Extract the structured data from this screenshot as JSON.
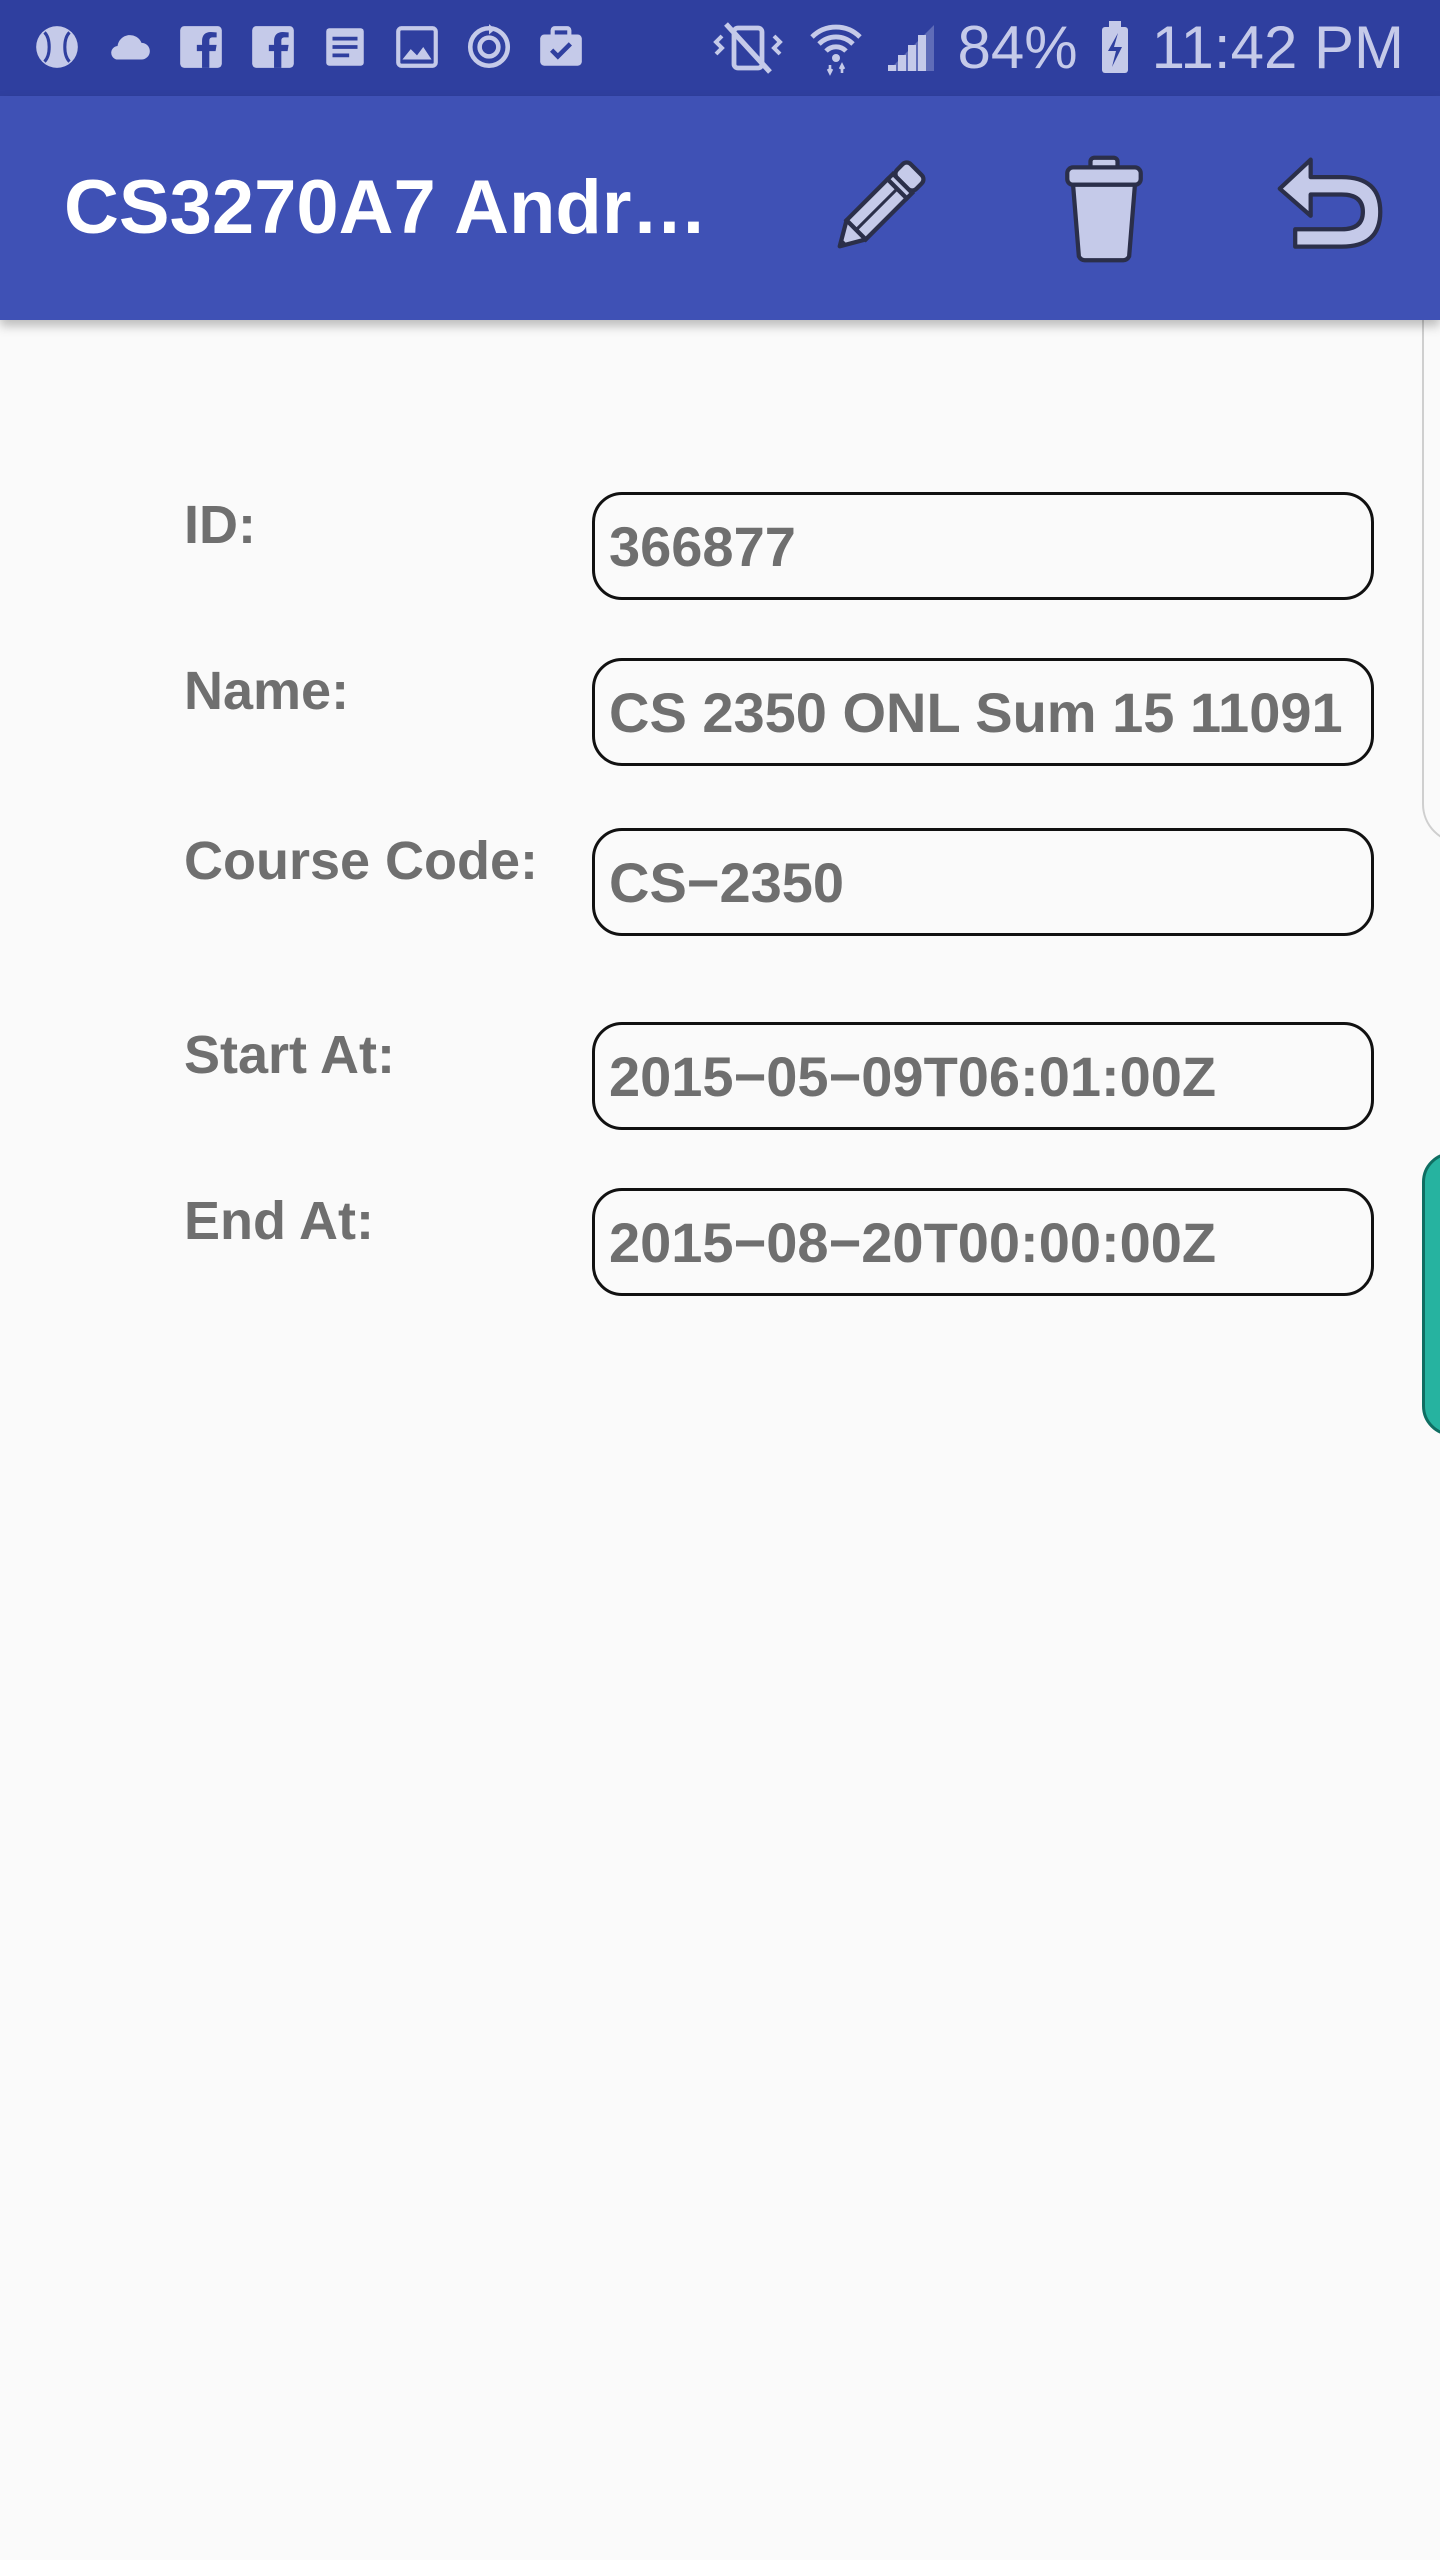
{
  "status_bar": {
    "notification_icons": [
      "baseball-icon",
      "cloud-icon",
      "facebook-icon",
      "facebook-icon",
      "document-icon",
      "image-icon",
      "sync-icon",
      "briefcase-check-icon"
    ],
    "system_icons": [
      "vibrate-mute-icon",
      "wifi-icon",
      "signal-icon",
      "battery-charging-icon"
    ],
    "battery": "84%",
    "time": "11:42 PM"
  },
  "app_bar": {
    "title": "CS3270A7 Andre…",
    "actions": [
      "pencil-icon",
      "trash-icon",
      "undo-icon"
    ]
  },
  "form": {
    "fields": [
      {
        "label": "ID:",
        "value": "366877"
      },
      {
        "label": "Name:",
        "value": "CS 2350 ONL Sum 15 11091"
      },
      {
        "label": "Course Code:",
        "value": "CS−2350"
      },
      {
        "label": "Start At:",
        "value": "2015−05−09T06:01:00Z"
      },
      {
        "label": "End At:",
        "value": "2015−08−20T00:00:00Z"
      }
    ]
  },
  "colors": {
    "status_bar": "#2f3f9f",
    "app_bar": "#3f51b5",
    "icon_tint": "#c5cae9",
    "background": "#fafafa",
    "label_text": "#6f6f6f",
    "edge_tab": "#26b3a0"
  }
}
